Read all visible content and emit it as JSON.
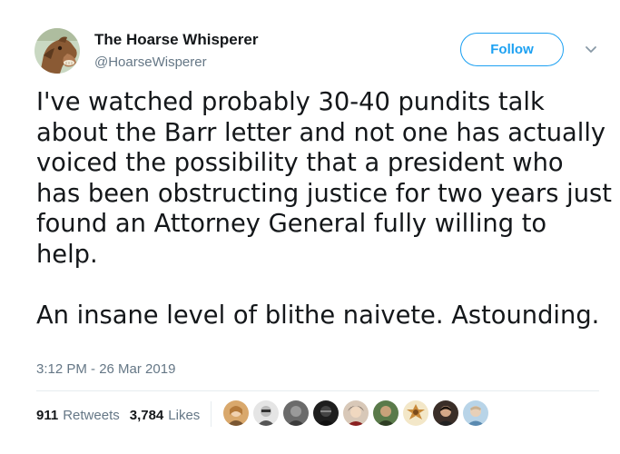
{
  "author": {
    "name": "The Hoarse Whisperer",
    "handle": "@HoarseWisperer",
    "avatar_icon": "horse-avatar-icon"
  },
  "header": {
    "follow_label": "Follow",
    "menu_icon": "chevron-down-icon"
  },
  "tweet": {
    "paragraph_1": "I've watched probably 30-40 pundits talk\nabout the Barr letter and not one has actually\nvoiced the possibility that a president who\nhas been obstructing justice for two years just\nfound an Attorney General fully willing to\nhelp.",
    "paragraph_2": "An insane level of blithe naivete. Astounding.",
    "timestamp": "3:12 PM - 26 Mar 2019"
  },
  "stats": {
    "retweets_count": "911",
    "retweets_label": "Retweets",
    "likes_count": "3,784",
    "likes_label": "Likes"
  },
  "likers": [
    {
      "icon": "user-avatar-icon"
    },
    {
      "icon": "user-avatar-icon"
    },
    {
      "icon": "user-avatar-icon"
    },
    {
      "icon": "user-avatar-icon"
    },
    {
      "icon": "user-avatar-icon"
    },
    {
      "icon": "user-avatar-icon"
    },
    {
      "icon": "user-avatar-icon"
    },
    {
      "icon": "user-avatar-icon"
    },
    {
      "icon": "user-avatar-icon"
    }
  ],
  "colors": {
    "accent": "#1da1f2",
    "text_primary": "#14171a",
    "text_secondary": "#657786",
    "divider": "#e6ecf0"
  }
}
